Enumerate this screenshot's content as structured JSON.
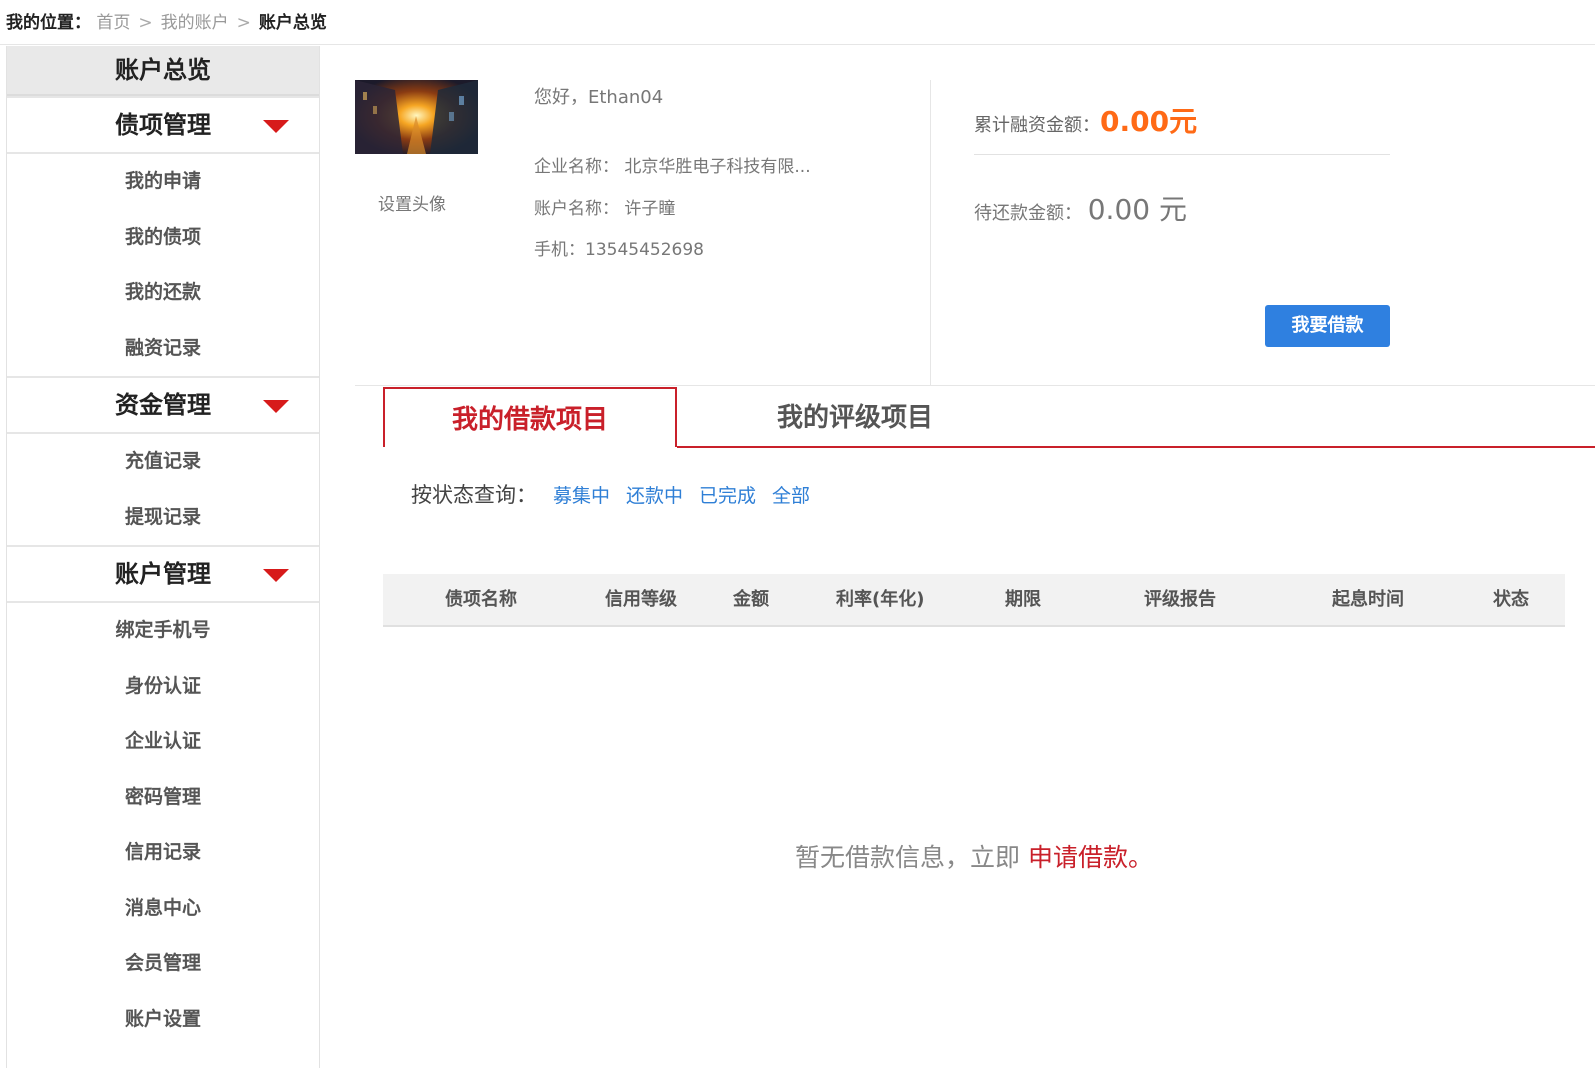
{
  "breadcrumb": {
    "label": "我的位置：",
    "items": [
      "首页",
      "我的账户"
    ],
    "separator": ">",
    "current": "账户总览"
  },
  "sidebar": {
    "title": "账户总览",
    "groups": [
      {
        "label": "债项管理",
        "items": [
          "我的申请",
          "我的债项",
          "我的还款",
          "融资记录"
        ]
      },
      {
        "label": "资金管理",
        "items": [
          "充值记录",
          "提现记录"
        ]
      },
      {
        "label": "账户管理",
        "items": [
          "绑定手机号",
          "身份认证",
          "企业认证",
          "密码管理",
          "信用记录",
          "消息中心",
          "会员管理",
          "账户设置"
        ]
      }
    ]
  },
  "profile": {
    "set_avatar": "设置头像",
    "greeting": "您好，Ethan04",
    "company_label": "企业名称：",
    "company_value": "北京华胜电子科技有限...",
    "account_label": "账户名称：",
    "account_value": "许子瞳",
    "phone_label": "手机：",
    "phone_value": "13545452698"
  },
  "stats": {
    "total_label": "累计融资金额：",
    "total_value": "0.00元",
    "pending_label": "待还款金额：",
    "pending_value": "0.00 元",
    "borrow_button": "我要借款"
  },
  "tabs": {
    "active": "我的借款项目",
    "other": "我的评级项目"
  },
  "filter": {
    "label": "按状态查询：",
    "options": [
      "募集中",
      "还款中",
      "已完成",
      "全部"
    ]
  },
  "table": {
    "headers": [
      "债项名称",
      "信用等级",
      "金额",
      "利率(年化)",
      "期限",
      "评级报告",
      "起息时间",
      "状态"
    ]
  },
  "empty": {
    "text": "暂无借款信息，立即",
    "link": "申请借款。"
  },
  "colors": {
    "accent_red": "#c9202a",
    "orange": "#ff6a16",
    "button_blue": "#2f80e0",
    "link_blue": "#2f7fd6"
  }
}
